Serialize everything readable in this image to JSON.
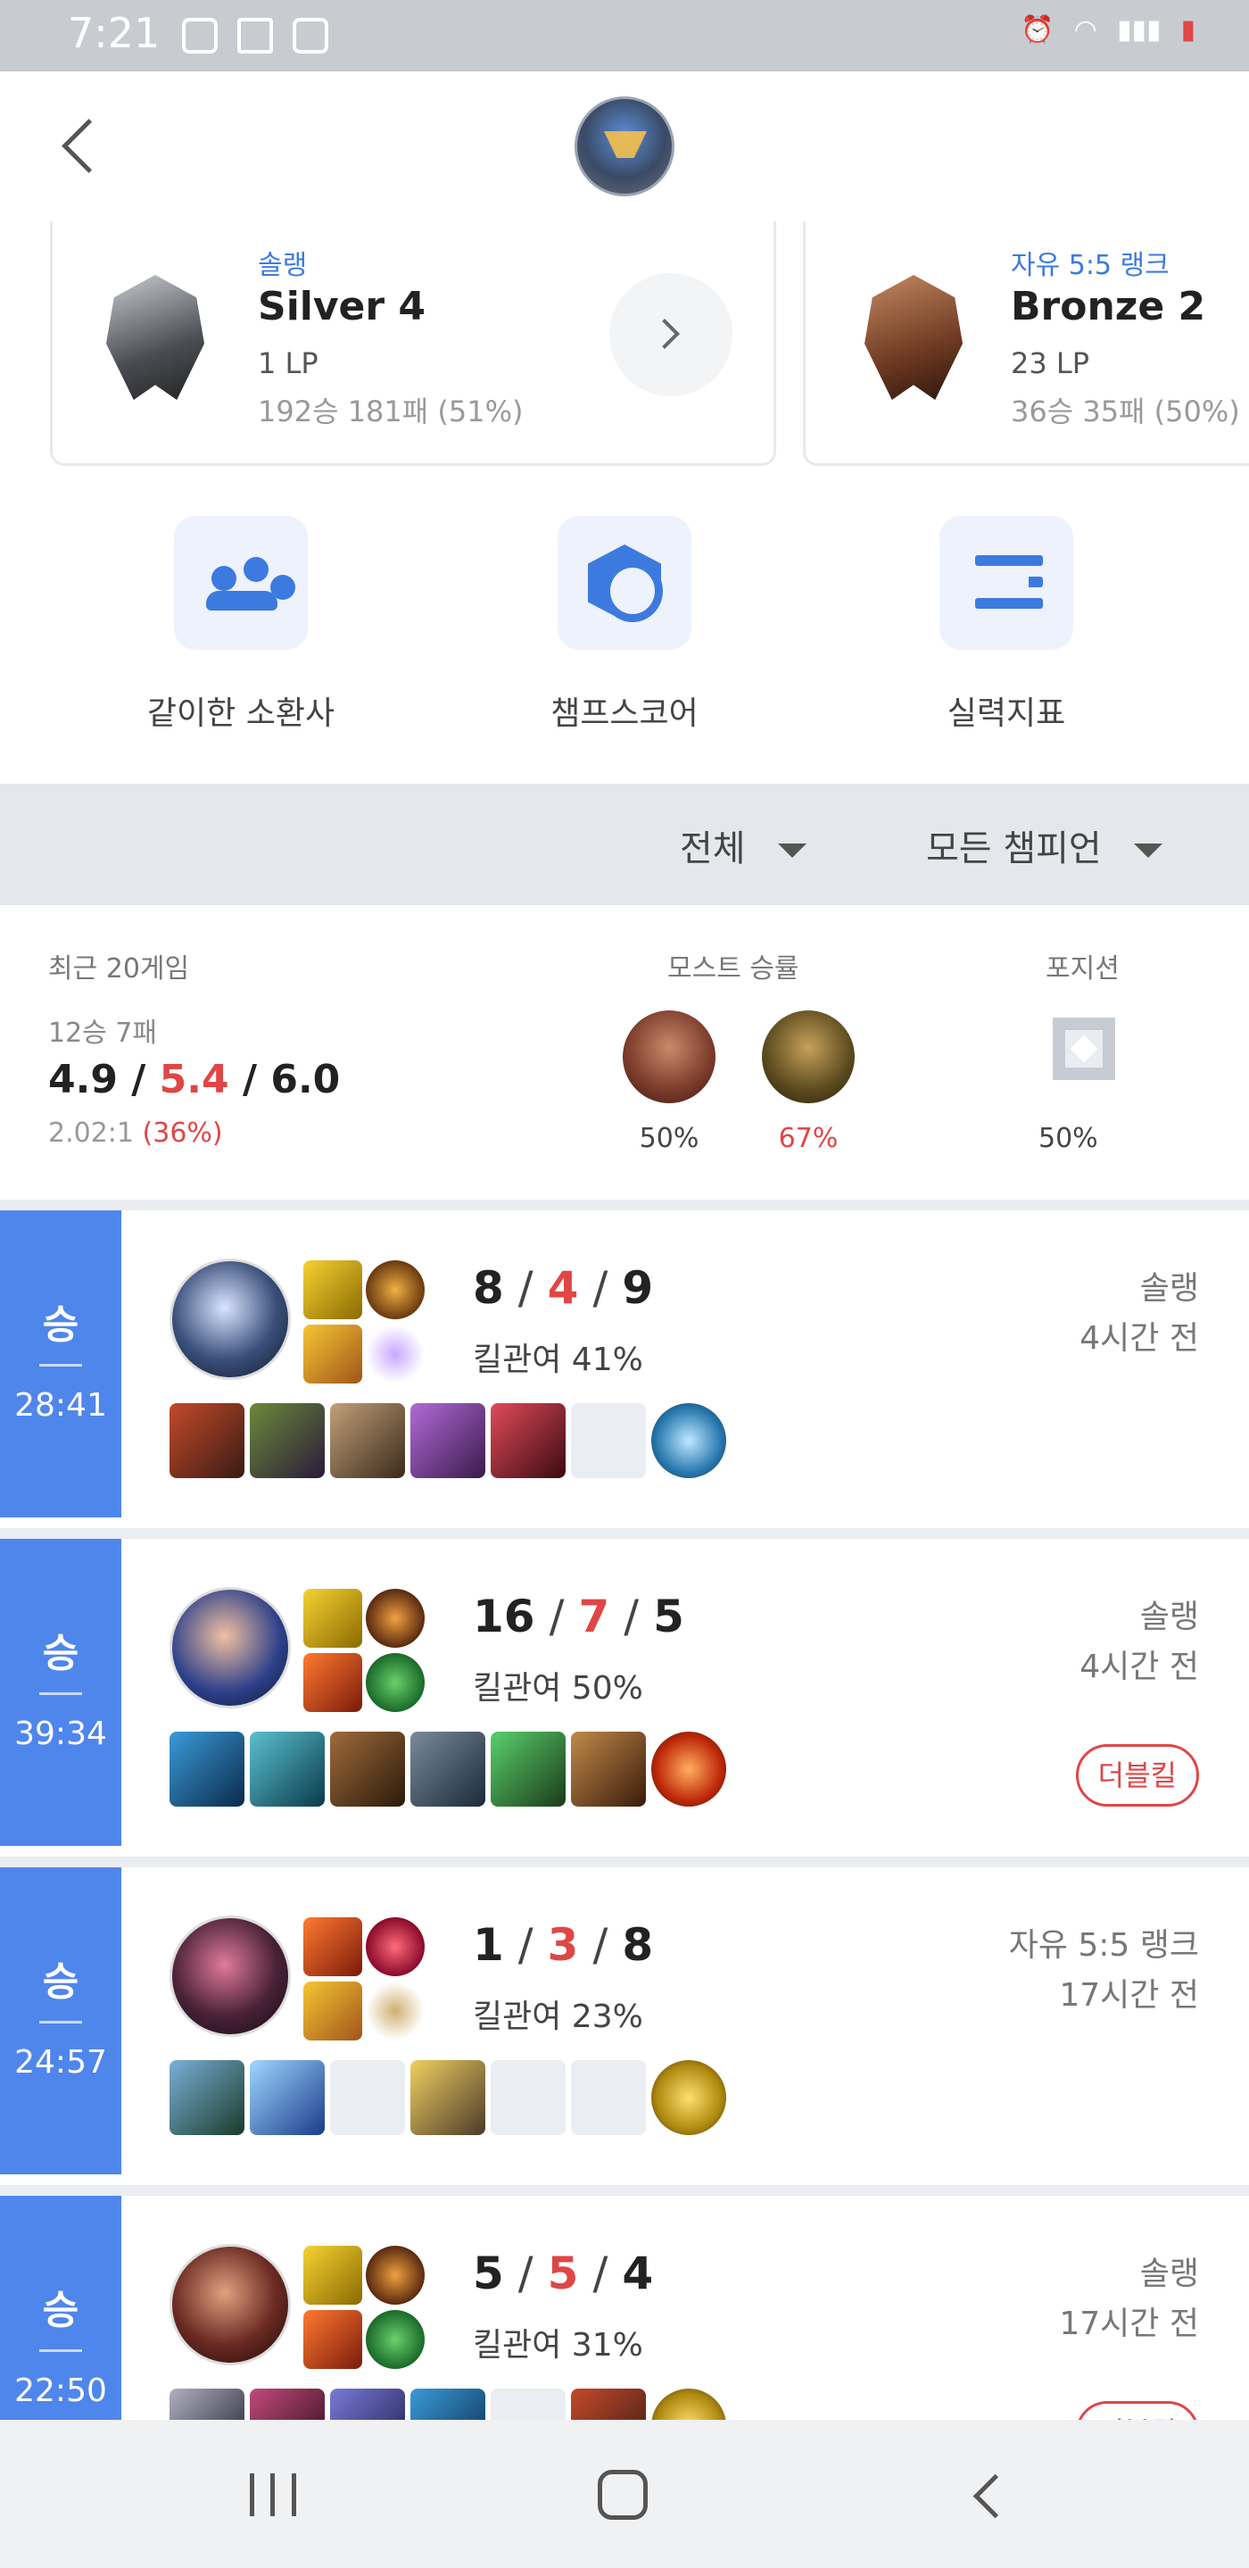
{
  "status_bar": {
    "time": "7:21"
  },
  "ranks": [
    {
      "queue": "솔랭",
      "tier": "Silver 4",
      "lp": "1 LP",
      "record": "192승 181패 (51%)"
    },
    {
      "queue": "자유 5:5 랭크",
      "tier": "Bronze 2",
      "lp": "23 LP",
      "record": "36승 35패 (50%)"
    }
  ],
  "shortcuts": [
    {
      "label": "같이한 소환사",
      "icon": "people-icon"
    },
    {
      "label": "챔프스코어",
      "icon": "hexagon-icon"
    },
    {
      "label": "실력지표",
      "icon": "bars-icon"
    }
  ],
  "filters": {
    "queue": "전체",
    "champion": "모든 챔피언"
  },
  "summary": {
    "recent_title": "최근 20게임",
    "most_title": "모스트 승률",
    "position_title": "포지션",
    "record": "12승 7패",
    "kda_k": "4.9",
    "kda_d": "5.4",
    "kda_a": "6.0",
    "ratio": "2.02:1",
    "ratio_pct": "(36%)",
    "most": [
      {
        "pct": "50%",
        "color": "#7a3a2a"
      },
      {
        "pct": "67%",
        "color": "#5b4a1e"
      }
    ],
    "position_pct": "50%"
  },
  "matches": [
    {
      "result": "승",
      "duration": "28:41",
      "kills": "8",
      "deaths": "4",
      "assists": "9",
      "kp": "킬관여 41%",
      "queue": "솔랭",
      "ago": "4시간 전",
      "badge": "",
      "champ_color": "#3a4f7a"
    },
    {
      "result": "승",
      "duration": "39:34",
      "kills": "16",
      "deaths": "7",
      "assists": "5",
      "kp": "킬관여 50%",
      "queue": "솔랭",
      "ago": "4시간 전",
      "badge": "더블킬",
      "champ_color": "#2c3f8a"
    },
    {
      "result": "승",
      "duration": "24:57",
      "kills": "1",
      "deaths": "3",
      "assists": "8",
      "kp": "킬관여 23%",
      "queue": "자유 5:5 랭크",
      "ago": "17시간 전",
      "badge": "",
      "champ_color": "#4a2238"
    },
    {
      "result": "승",
      "duration": "22:50",
      "kills": "5",
      "deaths": "5",
      "assists": "4",
      "kp": "킬관여 31%",
      "queue": "솔랭",
      "ago": "17시간 전",
      "badge": "더블킬",
      "champ_color": "#6a2a22"
    }
  ],
  "colors": {
    "accent": "#3d7ae0",
    "win_strip": "#4f86ec",
    "death_red": "#e04646"
  }
}
